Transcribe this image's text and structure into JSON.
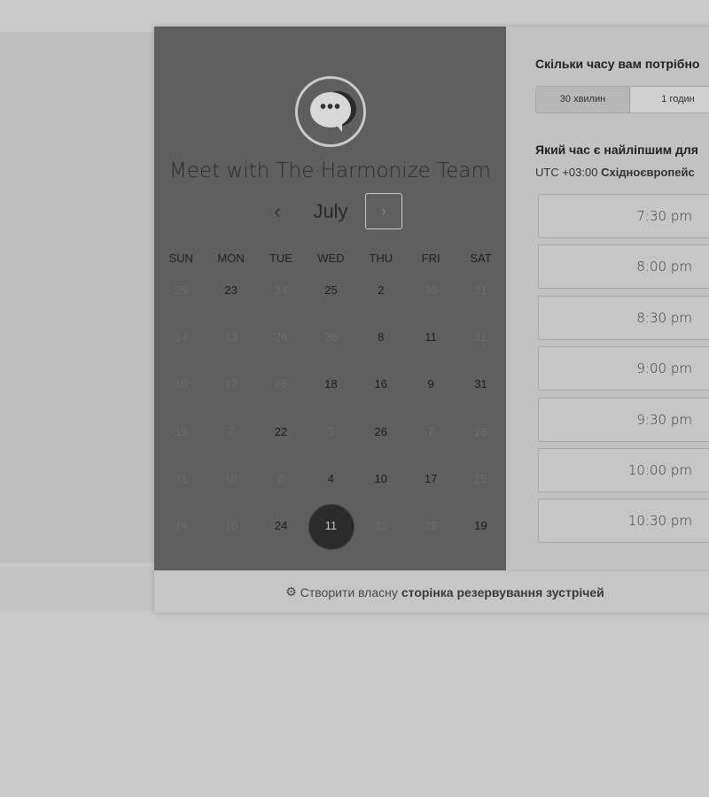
{
  "booking": {
    "team_name": "Meet with The Harmonize Team",
    "avatar_glyph": "•••",
    "month": "July",
    "prev_glyph": "‹",
    "next_glyph": "›",
    "weekdays": [
      "SUN",
      "MON",
      "TUE",
      "WED",
      "THU",
      "FRI",
      "SAT"
    ],
    "weeks": [
      [
        {
          "d": "25",
          "s": "dim"
        },
        {
          "d": "23",
          "s": "active"
        },
        {
          "d": "24",
          "s": "dim"
        },
        {
          "d": "25",
          "s": "active"
        },
        {
          "d": "2",
          "s": "active"
        },
        {
          "d": "30",
          "s": "dim"
        },
        {
          "d": "21",
          "s": "dim"
        }
      ],
      [
        {
          "d": "14",
          "s": "dim"
        },
        {
          "d": "13",
          "s": "dim"
        },
        {
          "d": "26",
          "s": "dim"
        },
        {
          "d": "26",
          "s": "dim"
        },
        {
          "d": "8",
          "s": "active"
        },
        {
          "d": "11",
          "s": "active"
        },
        {
          "d": "11",
          "s": "dim"
        }
      ],
      [
        {
          "d": "10",
          "s": "dim"
        },
        {
          "d": "17",
          "s": "dim"
        },
        {
          "d": "25",
          "s": "dim"
        },
        {
          "d": "18",
          "s": "active"
        },
        {
          "d": "16",
          "s": "active"
        },
        {
          "d": "9",
          "s": "active"
        },
        {
          "d": "31",
          "s": "active"
        }
      ],
      [
        {
          "d": "13",
          "s": "dim"
        },
        {
          "d": "7",
          "s": "dim"
        },
        {
          "d": "22",
          "s": "active"
        },
        {
          "d": "5",
          "s": "dim"
        },
        {
          "d": "26",
          "s": "active"
        },
        {
          "d": "7",
          "s": "dim"
        },
        {
          "d": "28",
          "s": "dim"
        }
      ],
      [
        {
          "d": "31",
          "s": "dim"
        },
        {
          "d": "18",
          "s": "dim"
        },
        {
          "d": "8",
          "s": "dim"
        },
        {
          "d": "4",
          "s": "active"
        },
        {
          "d": "10",
          "s": "active"
        },
        {
          "d": "17",
          "s": "active"
        },
        {
          "d": "15",
          "s": "dim"
        }
      ],
      [
        {
          "d": "14",
          "s": "dim"
        },
        {
          "d": "16",
          "s": "dim"
        },
        {
          "d": "24",
          "s": "active"
        },
        {
          "d": "11",
          "s": "selected"
        },
        {
          "d": "31",
          "s": "dim"
        },
        {
          "d": "26",
          "s": "dim"
        },
        {
          "d": "19",
          "s": "active"
        }
      ]
    ]
  },
  "scheduler": {
    "duration_question": "Скільки часу вам потрібно",
    "duration_options": [
      "30 хвилин",
      "1 годин"
    ],
    "selected_duration": "30 хвилин",
    "time_question": "Який час є найліпшим для",
    "timezone_offset": "UTC +03:00",
    "timezone_name": "Східноєвропейс",
    "slots": [
      "7:30 pm",
      "8:00 pm",
      "8:30 pm",
      "9:00 pm",
      "9:30 pm",
      "10:00 pm",
      "10:30 pm"
    ]
  },
  "footer": {
    "prefix": "Створити власну",
    "bold": "сторінка резервування зустрічей",
    "icon": "sprocket-icon",
    "icon_glyph": "⚙"
  }
}
